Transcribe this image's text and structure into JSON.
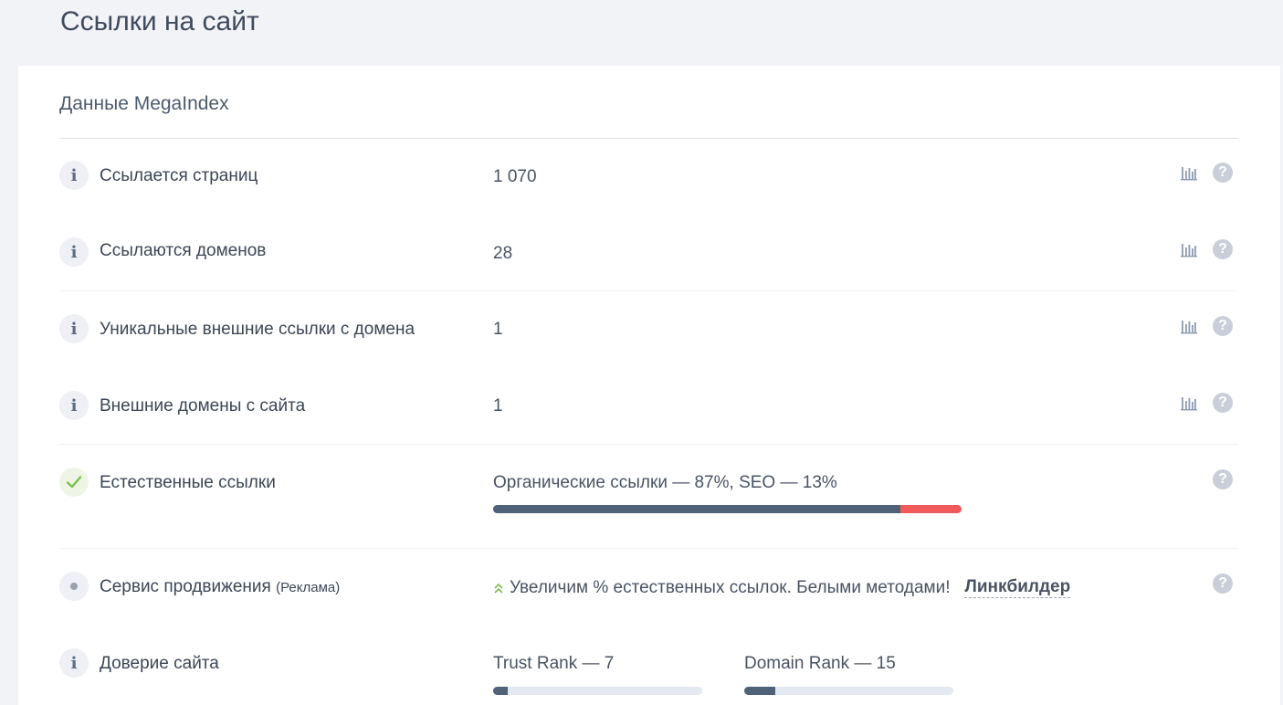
{
  "page": {
    "title": "Ссылки на сайт"
  },
  "card": {
    "title": "Данные MegaIndex"
  },
  "rows": [
    {
      "label": "Ссылается страниц",
      "value": "1 070",
      "icon": "info-icon"
    },
    {
      "label": "Ссылаются доменов",
      "value": "28",
      "icon": "info-icon"
    },
    {
      "label": "Уникальные внешние ссылки с домена",
      "value": "1",
      "icon": "info-icon"
    },
    {
      "label": "Внешние домены с сайта",
      "value": "1",
      "icon": "info-icon"
    }
  ],
  "natural_links": {
    "label": "Естественные ссылки",
    "summary": "Органические ссылки — 87%, SEO — 13%",
    "organic_fraction": 0.87,
    "seo_fraction": 0.13,
    "icon": "check-icon",
    "colors": {
      "organic": "#4f6278",
      "seo": "#f15a5a"
    }
  },
  "promo": {
    "label": "Сервис продвижения",
    "label_note": "(Реклама)",
    "text": "Увеличим % естественных ссылок. Белыми методами!",
    "link": "Линкбилдер",
    "icon": "dot-icon",
    "arrow_icon": "double-chevron-up-icon"
  },
  "trust": {
    "label": "Доверие сайта",
    "trust_rank_label": "Trust Rank — 7",
    "trust_rank_fraction": 0.07,
    "domain_rank_label": "Domain Rank — 15",
    "domain_rank_fraction": 0.15,
    "icon": "info-icon"
  },
  "icons": {
    "info_glyph": "i",
    "help_glyph": "?",
    "check_color": "#7cc04a"
  }
}
